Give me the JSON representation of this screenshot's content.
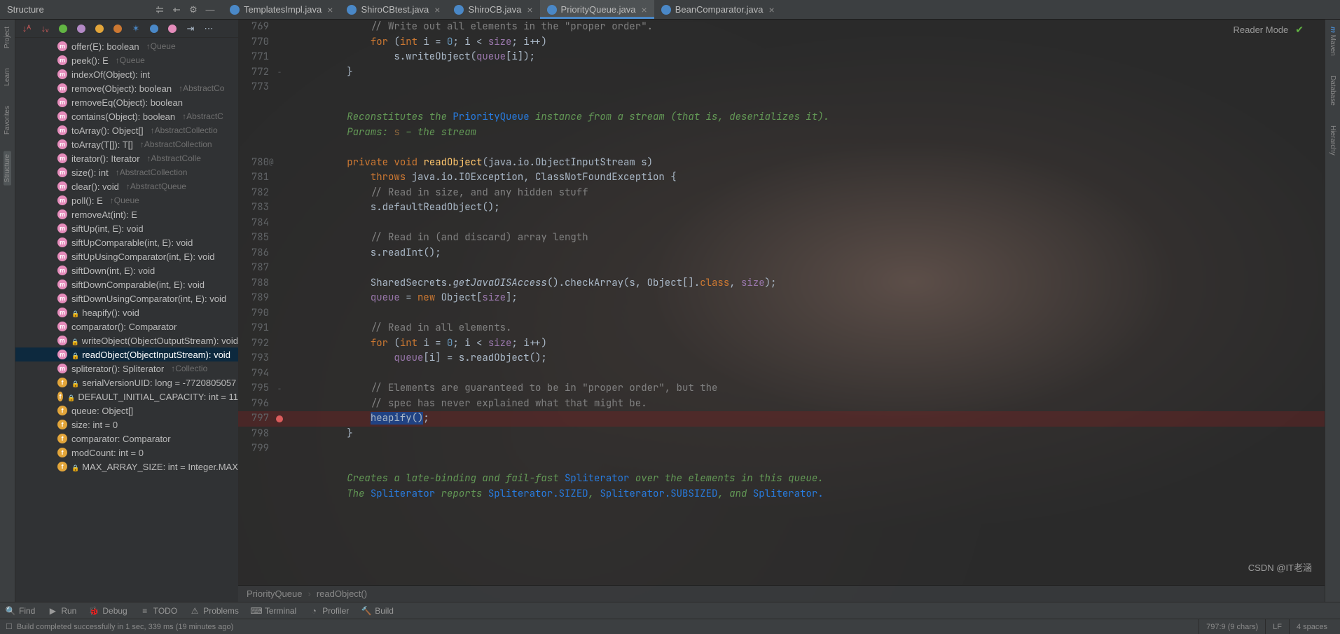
{
  "structure": {
    "title": "Structure",
    "nodes": [
      {
        "kind": "m",
        "lock": false,
        "label": "offer(E): boolean",
        "override": "↑Queue"
      },
      {
        "kind": "m",
        "lock": false,
        "label": "peek(): E",
        "override": "↑Queue"
      },
      {
        "kind": "m",
        "lock": false,
        "label": "indexOf(Object): int",
        "override": ""
      },
      {
        "kind": "m",
        "lock": false,
        "label": "remove(Object): boolean",
        "override": "↑AbstractCo"
      },
      {
        "kind": "m",
        "lock": false,
        "label": "removeEq(Object): boolean",
        "override": ""
      },
      {
        "kind": "m",
        "lock": false,
        "label": "contains(Object): boolean",
        "override": "↑AbstractC"
      },
      {
        "kind": "m",
        "lock": false,
        "label": "toArray(): Object[]",
        "override": "↑AbstractCollectio"
      },
      {
        "kind": "m",
        "lock": false,
        "label": "toArray(T[]): T[]",
        "override": "↑AbstractCollection"
      },
      {
        "kind": "m",
        "lock": false,
        "label": "iterator(): Iterator<E>",
        "override": "↑AbstractColle"
      },
      {
        "kind": "m",
        "lock": false,
        "label": "size(): int",
        "override": "↑AbstractCollection"
      },
      {
        "kind": "m",
        "lock": false,
        "label": "clear(): void",
        "override": "↑AbstractQueue"
      },
      {
        "kind": "m",
        "lock": false,
        "label": "poll(): E",
        "override": "↑Queue"
      },
      {
        "kind": "m",
        "lock": false,
        "label": "removeAt(int): E",
        "override": ""
      },
      {
        "kind": "m",
        "lock": false,
        "label": "siftUp(int, E): void",
        "override": ""
      },
      {
        "kind": "m",
        "lock": false,
        "label": "siftUpComparable(int, E): void",
        "override": ""
      },
      {
        "kind": "m",
        "lock": false,
        "label": "siftUpUsingComparator(int, E): void",
        "override": ""
      },
      {
        "kind": "m",
        "lock": false,
        "label": "siftDown(int, E): void",
        "override": ""
      },
      {
        "kind": "m",
        "lock": false,
        "label": "siftDownComparable(int, E): void",
        "override": ""
      },
      {
        "kind": "m",
        "lock": false,
        "label": "siftDownUsingComparator(int, E): void",
        "override": ""
      },
      {
        "kind": "m",
        "lock": true,
        "label": "heapify(): void",
        "override": ""
      },
      {
        "kind": "m",
        "lock": false,
        "label": "comparator(): Comparator<? super E>",
        "override": ""
      },
      {
        "kind": "m",
        "lock": true,
        "label": "writeObject(ObjectOutputStream): void",
        "override": ""
      },
      {
        "kind": "m",
        "lock": true,
        "label": "readObject(ObjectInputStream): void",
        "override": "",
        "selected": true
      },
      {
        "kind": "m",
        "lock": false,
        "label": "spliterator(): Spliterator<E>",
        "override": "↑Collectio"
      },
      {
        "kind": "f",
        "lock": true,
        "label": "serialVersionUID: long = -7720805057",
        "override": ""
      },
      {
        "kind": "f",
        "lock": true,
        "label": "DEFAULT_INITIAL_CAPACITY: int = 11",
        "override": ""
      },
      {
        "kind": "f",
        "lock": false,
        "label": "queue: Object[]",
        "override": ""
      },
      {
        "kind": "f",
        "lock": false,
        "label": "size: int = 0",
        "override": ""
      },
      {
        "kind": "f",
        "lock": false,
        "label": "comparator: Comparator<? super E>",
        "override": ""
      },
      {
        "kind": "f",
        "lock": false,
        "label": "modCount: int = 0",
        "override": ""
      },
      {
        "kind": "f",
        "lock": true,
        "label": "MAX_ARRAY_SIZE: int = Integer.MAX",
        "override": ""
      }
    ]
  },
  "tabs": [
    {
      "icon": "class",
      "label": "TemplatesImpl.java",
      "active": false
    },
    {
      "icon": "class",
      "label": "ShiroCBtest.java",
      "active": false
    },
    {
      "icon": "class",
      "label": "ShiroCB.java",
      "active": false
    },
    {
      "icon": "class",
      "label": "PriorityQueue.java",
      "active": true
    },
    {
      "icon": "class",
      "label": "BeanComparator.java",
      "active": false
    }
  ],
  "left_sidebar": [
    {
      "label": "Project"
    },
    {
      "label": "Learn"
    },
    {
      "label": "Favorites"
    },
    {
      "label": "Structure",
      "active": true
    }
  ],
  "right_sidebar": [
    {
      "label": "Maven",
      "icon": "m"
    },
    {
      "label": "Database"
    },
    {
      "label": "Hierarchy"
    }
  ],
  "reader_mode_label": "Reader Mode",
  "breadcrumb": [
    "PriorityQueue",
    "readObject()"
  ],
  "bottom_tools": [
    {
      "icon": "search",
      "label": "Find"
    },
    {
      "icon": "play",
      "label": "Run"
    },
    {
      "icon": "bug",
      "label": "Debug"
    },
    {
      "icon": "todo",
      "label": "TODO"
    },
    {
      "icon": "warn",
      "label": "Problems"
    },
    {
      "icon": "term",
      "label": "Terminal"
    },
    {
      "icon": "prof",
      "label": "Profiler"
    },
    {
      "icon": "build",
      "label": "Build"
    }
  ],
  "status": {
    "build_msg": "Build completed successfully in 1 sec, 339 ms (19 minutes ago)",
    "cursor": "797:9 (9 chars)",
    "encoding": "LF",
    "indent": "4 spaces"
  },
  "watermark": "CSDN @IT老涵",
  "code_lines": [
    {
      "n": 769,
      "html": "            <span class='c-com'>// Write out all elements in the \"proper order\".</span>"
    },
    {
      "n": 770,
      "html": "            <span class='c-kw'>for</span> (<span class='c-kw'>int</span> i = <span class='c-num'>0</span>; i &lt; <span class='c-field'>size</span>; i++)"
    },
    {
      "n": 771,
      "html": "                s.writeObject(<span class='c-field'>queue</span>[i]);"
    },
    {
      "n": 772,
      "html": "        }",
      "gut_ex": "−"
    },
    {
      "n": 773,
      "html": ""
    },
    {
      "n": "",
      "html": ""
    },
    {
      "n": "",
      "html": "        <span class='c-doc'>Reconstitutes the </span><span class='c-link'>PriorityQueue</span><span class='c-doc'> instance from a stream (that is, deserializes it).</span>"
    },
    {
      "n": "",
      "html": "        <span class='c-doc'>Params: </span><span class='c-doc2'>s</span><span class='c-doc'> – the stream</span>"
    },
    {
      "n": "",
      "html": ""
    },
    {
      "n": 780,
      "html": "        <span class='c-kw'>private</span> <span class='c-kw'>void</span> <span class='c-fn'>readObject</span>(java.io.ObjectInputStream s)",
      "gut_ov": "@"
    },
    {
      "n": 781,
      "html": "            <span class='c-kw'>throws</span> java.io.IOException, ClassNotFoundException {"
    },
    {
      "n": 782,
      "html": "            <span class='c-com'>// Read in size, and any hidden stuff</span>"
    },
    {
      "n": 783,
      "html": "            s.defaultReadObject();"
    },
    {
      "n": 784,
      "html": ""
    },
    {
      "n": 785,
      "html": "            <span class='c-com'>// Read in (and discard) array length</span>"
    },
    {
      "n": 786,
      "html": "            s.readInt();"
    },
    {
      "n": 787,
      "html": ""
    },
    {
      "n": 788,
      "html": "            SharedSecrets.<span class='c-static'>getJavaOISAccess</span>().checkArray(s, Object[].<span class='c-kw'>class</span>, <span class='c-field'>size</span>);"
    },
    {
      "n": 789,
      "html": "            <span class='c-field'>queue</span> = <span class='c-kw'>new</span> Object[<span class='c-field'>size</span>];"
    },
    {
      "n": 790,
      "html": ""
    },
    {
      "n": 791,
      "html": "            <span class='c-com'>// Read in all elements.</span>"
    },
    {
      "n": 792,
      "html": "            <span class='c-kw'>for</span> (<span class='c-kw'>int</span> i = <span class='c-num'>0</span>; i &lt; <span class='c-field'>size</span>; i++)"
    },
    {
      "n": 793,
      "html": "                <span class='c-field'>queue</span>[i] = s.readObject();"
    },
    {
      "n": 794,
      "html": ""
    },
    {
      "n": 795,
      "html": "            <span class='c-com'>// Elements are guaranteed to be in \"proper order\", but the</span>",
      "gut_ex": "−"
    },
    {
      "n": 796,
      "html": "            <span class='c-com'>// spec has never explained what that might be.</span>"
    },
    {
      "n": 797,
      "html": "            <span class='c-hl'>heapify()</span>;",
      "bp": true,
      "hl": true
    },
    {
      "n": 798,
      "html": "        }"
    },
    {
      "n": 799,
      "html": ""
    },
    {
      "n": "",
      "html": ""
    },
    {
      "n": "",
      "html": "        <span class='c-doc'>Creates a </span><span class='c-doc' style='font-style:italic'>late-binding</span><span class='c-doc'> and </span><span class='c-doc' style='font-style:italic'>fail-fast</span> <span class='c-link'>Spliterator</span><span class='c-doc'> over the elements in this queue.</span>"
    },
    {
      "n": "",
      "html": "        <span class='c-doc'>The </span><span class='c-link'>Spliterator</span><span class='c-doc'> reports </span><span class='c-link'>Spliterator.SIZED</span><span class='c-doc'>, </span><span class='c-link'>Spliterator.SUBSIZED</span><span class='c-doc'>, and </span><span class='c-link'>Spliterator.</span>"
    }
  ]
}
